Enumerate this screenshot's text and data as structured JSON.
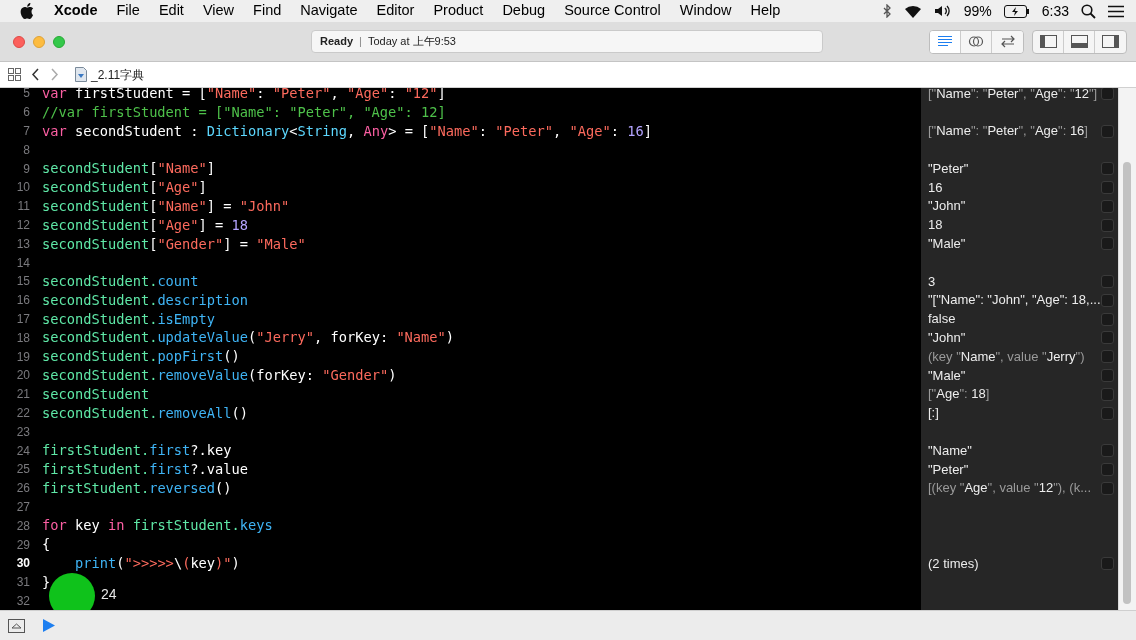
{
  "menu_bar": {
    "app": "Xcode",
    "items": [
      "File",
      "Edit",
      "View",
      "Find",
      "Navigate",
      "Editor",
      "Product",
      "Debug",
      "Source Control",
      "Window",
      "Help"
    ],
    "battery": "99%",
    "clock": "6:33"
  },
  "toolbar": {
    "status": "Ready",
    "separator": "|",
    "activity": "Today at 上午9:53",
    "editor_modes": [
      {
        "selected": true
      },
      {
        "selected": false
      },
      {
        "selected": false
      }
    ]
  },
  "jump_bar": {
    "file": "_2.11字典"
  },
  "editor": {
    "lines": [
      {
        "number": "5",
        "current": false,
        "tokens": [
          {
            "text": "var",
            "kind": "kw"
          },
          {
            "text": " firstStudent = [",
            "kind": "plain"
          },
          {
            "text": "\"Name\"",
            "kind": "str"
          },
          {
            "text": ": ",
            "kind": "plain"
          },
          {
            "text": "\"Peter\"",
            "kind": "str"
          },
          {
            "text": ", ",
            "kind": "plain"
          },
          {
            "text": "\"Age\"",
            "kind": "str"
          },
          {
            "text": ": ",
            "kind": "plain"
          },
          {
            "text": "\"12\"",
            "kind": "str"
          },
          {
            "text": "]",
            "kind": "plain"
          }
        ],
        "result": [
          {
            "text": "[\"",
            "kind": "dim"
          },
          {
            "text": "Name",
            "kind": "bright"
          },
          {
            "text": "\": \"",
            "kind": "dim"
          },
          {
            "text": "Peter",
            "kind": "bright"
          },
          {
            "text": "\", \"",
            "kind": "dim"
          },
          {
            "text": "Age",
            "kind": "bright"
          },
          {
            "text": "\": \"",
            "kind": "dim"
          },
          {
            "text": "12",
            "kind": "bright"
          },
          {
            "text": "\"]",
            "kind": "dim"
          }
        ]
      },
      {
        "number": "6",
        "current": false,
        "tokens": [
          {
            "text": "//var firstStudent = [\"Name\": \"Peter\", \"Age\": 12]",
            "kind": "comment"
          }
        ]
      },
      {
        "number": "7",
        "current": false,
        "tokens": [
          {
            "text": "var",
            "kind": "kw"
          },
          {
            "text": " secondStudent : ",
            "kind": "plain"
          },
          {
            "text": "Dictionary",
            "kind": "type"
          },
          {
            "text": "<",
            "kind": "plain"
          },
          {
            "text": "String",
            "kind": "type"
          },
          {
            "text": ", ",
            "kind": "plain"
          },
          {
            "text": "Any",
            "kind": "kw"
          },
          {
            "text": "> = [",
            "kind": "plain"
          },
          {
            "text": "\"Name\"",
            "kind": "str"
          },
          {
            "text": ": ",
            "kind": "plain"
          },
          {
            "text": "\"Peter\"",
            "kind": "str"
          },
          {
            "text": ", ",
            "kind": "plain"
          },
          {
            "text": "\"Age\"",
            "kind": "str"
          },
          {
            "text": ": ",
            "kind": "plain"
          },
          {
            "text": "16",
            "kind": "num"
          },
          {
            "text": "]",
            "kind": "plain"
          }
        ],
        "result": [
          {
            "text": "[\"",
            "kind": "dim"
          },
          {
            "text": "Name",
            "kind": "bright"
          },
          {
            "text": "\": \"",
            "kind": "dim"
          },
          {
            "text": "Peter",
            "kind": "bright"
          },
          {
            "text": "\", \"",
            "kind": "dim"
          },
          {
            "text": "Age",
            "kind": "bright"
          },
          {
            "text": "\": ",
            "kind": "dim"
          },
          {
            "text": "16",
            "kind": "bright"
          },
          {
            "text": "]",
            "kind": "dim"
          }
        ]
      },
      {
        "number": "8",
        "current": false
      },
      {
        "number": "9",
        "current": false,
        "tokens": [
          {
            "text": "secondStudent",
            "kind": "ident"
          },
          {
            "text": "[",
            "kind": "plain"
          },
          {
            "text": "\"Name\"",
            "kind": "str"
          },
          {
            "text": "]",
            "kind": "plain"
          }
        ],
        "result": [
          {
            "text": "\"Peter\"",
            "kind": "bright"
          }
        ]
      },
      {
        "number": "10",
        "current": false,
        "tokens": [
          {
            "text": "secondStudent",
            "kind": "ident"
          },
          {
            "text": "[",
            "kind": "plain"
          },
          {
            "text": "\"Age\"",
            "kind": "str"
          },
          {
            "text": "]",
            "kind": "plain"
          }
        ],
        "result": [
          {
            "text": "16",
            "kind": "bright"
          }
        ]
      },
      {
        "number": "11",
        "current": false,
        "tokens": [
          {
            "text": "secondStudent",
            "kind": "ident"
          },
          {
            "text": "[",
            "kind": "plain"
          },
          {
            "text": "\"Name\"",
            "kind": "str"
          },
          {
            "text": "] = ",
            "kind": "plain"
          },
          {
            "text": "\"John\"",
            "kind": "str"
          }
        ],
        "result": [
          {
            "text": "\"John\"",
            "kind": "bright"
          }
        ]
      },
      {
        "number": "12",
        "current": false,
        "tokens": [
          {
            "text": "secondStudent",
            "kind": "ident"
          },
          {
            "text": "[",
            "kind": "plain"
          },
          {
            "text": "\"Age\"",
            "kind": "str"
          },
          {
            "text": "] = ",
            "kind": "plain"
          },
          {
            "text": "18",
            "kind": "num"
          }
        ],
        "result": [
          {
            "text": "18",
            "kind": "bright"
          }
        ]
      },
      {
        "number": "13",
        "current": false,
        "tokens": [
          {
            "text": "secondStudent",
            "kind": "ident"
          },
          {
            "text": "[",
            "kind": "plain"
          },
          {
            "text": "\"Gender\"",
            "kind": "str"
          },
          {
            "text": "] = ",
            "kind": "plain"
          },
          {
            "text": "\"Male\"",
            "kind": "str"
          }
        ],
        "result": [
          {
            "text": "\"Male\"",
            "kind": "bright"
          }
        ]
      },
      {
        "number": "14",
        "current": false
      },
      {
        "number": "15",
        "current": false,
        "tokens": [
          {
            "text": "secondStudent.",
            "kind": "ident"
          },
          {
            "text": "count",
            "kind": "member"
          }
        ],
        "result": [
          {
            "text": "3",
            "kind": "bright"
          }
        ]
      },
      {
        "number": "16",
        "current": false,
        "tokens": [
          {
            "text": "secondStudent.",
            "kind": "ident"
          },
          {
            "text": "description",
            "kind": "member"
          }
        ],
        "result": [
          {
            "text": "\"[\"Name\": \"John\", \"Age\": 18,...",
            "kind": "bright"
          }
        ]
      },
      {
        "number": "17",
        "current": false,
        "tokens": [
          {
            "text": "secondStudent.",
            "kind": "ident"
          },
          {
            "text": "isEmpty",
            "kind": "member"
          }
        ],
        "result": [
          {
            "text": "false",
            "kind": "bright"
          }
        ]
      },
      {
        "number": "18",
        "current": false,
        "tokens": [
          {
            "text": "secondStudent.",
            "kind": "ident"
          },
          {
            "text": "updateValue",
            "kind": "member"
          },
          {
            "text": "(",
            "kind": "plain"
          },
          {
            "text": "\"Jerry\"",
            "kind": "str"
          },
          {
            "text": ", forKey: ",
            "kind": "plain"
          },
          {
            "text": "\"Name\"",
            "kind": "str"
          },
          {
            "text": ")",
            "kind": "plain"
          }
        ],
        "result": [
          {
            "text": "\"John\"",
            "kind": "bright"
          }
        ]
      },
      {
        "number": "19",
        "current": false,
        "tokens": [
          {
            "text": "secondStudent.",
            "kind": "ident"
          },
          {
            "text": "popFirst",
            "kind": "member"
          },
          {
            "text": "()",
            "kind": "plain"
          }
        ],
        "result": [
          {
            "text": "(key \"",
            "kind": "dim"
          },
          {
            "text": "Name",
            "kind": "bright"
          },
          {
            "text": "\", value \"",
            "kind": "dim"
          },
          {
            "text": "Jerry",
            "kind": "bright"
          },
          {
            "text": "\")",
            "kind": "dim"
          }
        ]
      },
      {
        "number": "20",
        "current": false,
        "tokens": [
          {
            "text": "secondStudent.",
            "kind": "ident"
          },
          {
            "text": "removeValue",
            "kind": "member"
          },
          {
            "text": "(forKey: ",
            "kind": "plain"
          },
          {
            "text": "\"Gender\"",
            "kind": "str"
          },
          {
            "text": ")",
            "kind": "plain"
          }
        ],
        "result": [
          {
            "text": "\"Male\"",
            "kind": "bright"
          }
        ]
      },
      {
        "number": "21",
        "current": false,
        "tokens": [
          {
            "text": "secondStudent",
            "kind": "ident"
          }
        ],
        "result": [
          {
            "text": "[\"",
            "kind": "dim"
          },
          {
            "text": "Age",
            "kind": "bright"
          },
          {
            "text": "\": ",
            "kind": "dim"
          },
          {
            "text": "18",
            "kind": "bright"
          },
          {
            "text": "]",
            "kind": "dim"
          }
        ]
      },
      {
        "number": "22",
        "current": false,
        "tokens": [
          {
            "text": "secondStudent.",
            "kind": "ident"
          },
          {
            "text": "removeAll",
            "kind": "member"
          },
          {
            "text": "()",
            "kind": "plain"
          }
        ],
        "result": [
          {
            "text": "[:]",
            "kind": "bright"
          }
        ]
      },
      {
        "number": "23",
        "current": false
      },
      {
        "number": "24",
        "current": false,
        "tokens": [
          {
            "text": "firstStudent.",
            "kind": "ident"
          },
          {
            "text": "first",
            "kind": "member"
          },
          {
            "text": "?.key",
            "kind": "plain"
          }
        ],
        "result": [
          {
            "text": "\"Name\"",
            "kind": "bright"
          }
        ]
      },
      {
        "number": "25",
        "current": false,
        "tokens": [
          {
            "text": "firstStudent.",
            "kind": "ident"
          },
          {
            "text": "first",
            "kind": "member"
          },
          {
            "text": "?.value",
            "kind": "plain"
          }
        ],
        "result": [
          {
            "text": "\"Peter\"",
            "kind": "bright"
          }
        ]
      },
      {
        "number": "26",
        "current": false,
        "tokens": [
          {
            "text": "firstStudent.",
            "kind": "ident"
          },
          {
            "text": "reversed",
            "kind": "member"
          },
          {
            "text": "()",
            "kind": "plain"
          }
        ],
        "result": [
          {
            "text": "[(key \"",
            "kind": "dim"
          },
          {
            "text": "Age",
            "kind": "bright"
          },
          {
            "text": "\", value \"",
            "kind": "dim"
          },
          {
            "text": "12",
            "kind": "bright"
          },
          {
            "text": "\"), (k...",
            "kind": "dim"
          }
        ]
      },
      {
        "number": "27",
        "current": false
      },
      {
        "number": "28",
        "current": false,
        "tokens": [
          {
            "text": "for",
            "kind": "kw"
          },
          {
            "text": " key ",
            "kind": "plain"
          },
          {
            "text": "in",
            "kind": "kw"
          },
          {
            "text": " firstStudent.",
            "kind": "ident"
          },
          {
            "text": "keys",
            "kind": "member"
          }
        ]
      },
      {
        "number": "29",
        "current": false,
        "tokens": [
          {
            "text": "{",
            "kind": "plain"
          }
        ]
      },
      {
        "number": "30",
        "current": true,
        "tokens": [
          {
            "text": "    print",
            "kind": "member"
          },
          {
            "text": "(",
            "kind": "plain"
          },
          {
            "text": "\">>>>>",
            "kind": "str"
          },
          {
            "text": "\\",
            "kind": "plain"
          },
          {
            "text": "(",
            "kind": "str"
          },
          {
            "text": "key",
            "kind": "plain"
          },
          {
            "text": ")\"",
            "kind": "str"
          },
          {
            "text": ")",
            "kind": "plain"
          }
        ],
        "result": [
          {
            "text": "(2 times)",
            "kind": "bright"
          }
        ]
      },
      {
        "number": "31",
        "current": false,
        "tokens": [
          {
            "text": "}",
            "kind": "plain"
          }
        ]
      },
      {
        "number": "32",
        "current": false
      }
    ]
  },
  "click_overlay": {
    "label": "24"
  }
}
